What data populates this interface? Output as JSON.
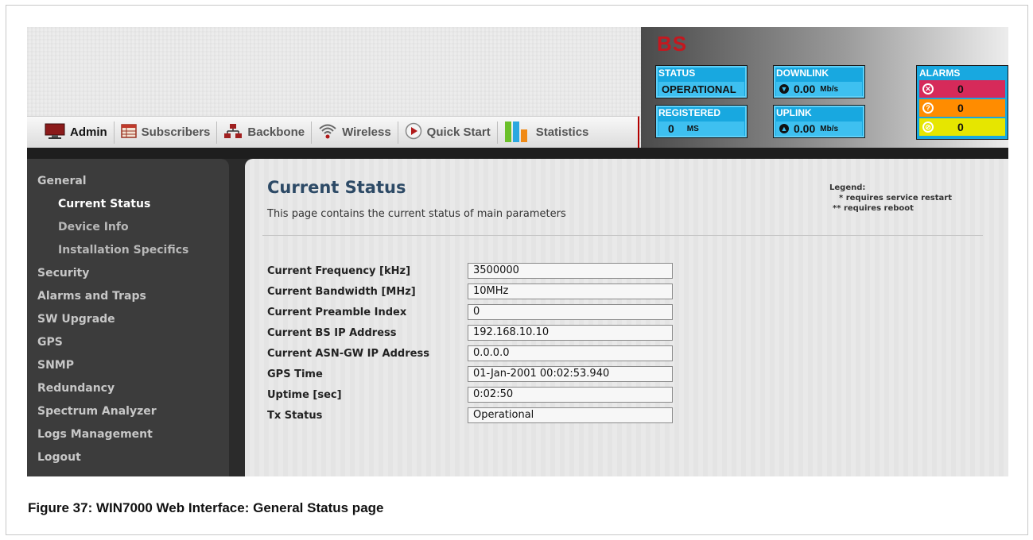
{
  "nav": {
    "items": [
      {
        "label": "Admin",
        "icon": "monitor-icon"
      },
      {
        "label": "Subscribers",
        "icon": "table-icon"
      },
      {
        "label": "Backbone",
        "icon": "network-icon"
      },
      {
        "label": "Wireless",
        "icon": "wifi-icon"
      },
      {
        "label": "Quick Start",
        "icon": "play-icon"
      },
      {
        "label": "Statistics",
        "icon": "bar-chart-icon"
      }
    ]
  },
  "status_panel": {
    "title": "BS",
    "status": {
      "label": "STATUS",
      "value": "OPERATIONAL"
    },
    "registered": {
      "label": "REGISTERED",
      "value": "0",
      "unit": "MS"
    },
    "downlink": {
      "label": "DOWNLINK",
      "value": "0.00",
      "unit": "Mb/s"
    },
    "uplink": {
      "label": "UPLINK",
      "value": "0.00",
      "unit": "Mb/s"
    },
    "alarms": {
      "label": "ALARMS",
      "critical": "0",
      "major": "0",
      "minor": "0",
      "colors": {
        "critical": "#d62a5a",
        "major": "#ff8c00",
        "minor": "#e6e600"
      }
    }
  },
  "sidebar": {
    "items": [
      {
        "label": "General",
        "level": 0
      },
      {
        "label": "Current Status",
        "level": 1,
        "active": true
      },
      {
        "label": "Device Info",
        "level": 1
      },
      {
        "label": "Installation Specifics",
        "level": 1
      },
      {
        "label": "Security",
        "level": 0
      },
      {
        "label": "Alarms and Traps",
        "level": 0
      },
      {
        "label": "SW Upgrade",
        "level": 0
      },
      {
        "label": "GPS",
        "level": 0
      },
      {
        "label": "SNMP",
        "level": 0
      },
      {
        "label": "Redundancy",
        "level": 0
      },
      {
        "label": "Spectrum Analyzer",
        "level": 0
      },
      {
        "label": "Logs Management",
        "level": 0
      },
      {
        "label": "Logout",
        "level": 0
      }
    ]
  },
  "content": {
    "title": "Current Status",
    "description": "This page contains the current status of main parameters",
    "legend": {
      "title": "Legend:",
      "restart_mark": "*",
      "restart_text": "requires service restart",
      "reboot_mark": "**",
      "reboot_text": "requires reboot"
    },
    "fields": [
      {
        "label": "Current Frequency [kHz]",
        "value": "3500000"
      },
      {
        "label": "Current Bandwidth [MHz]",
        "value": "10MHz"
      },
      {
        "label": "Current Preamble Index",
        "value": "0"
      },
      {
        "label": "Current BS IP Address",
        "value": "192.168.10.10"
      },
      {
        "label": "Current ASN-GW IP Address",
        "value": "0.0.0.0"
      },
      {
        "label": "GPS Time",
        "value": "01-Jan-2001 00:02:53.940"
      },
      {
        "label": "Uptime [sec]",
        "value": "0:02:50"
      },
      {
        "label": "Tx Status",
        "value": "Operational"
      }
    ]
  },
  "caption": "Figure 37: WIN7000 Web Interface: General Status page"
}
